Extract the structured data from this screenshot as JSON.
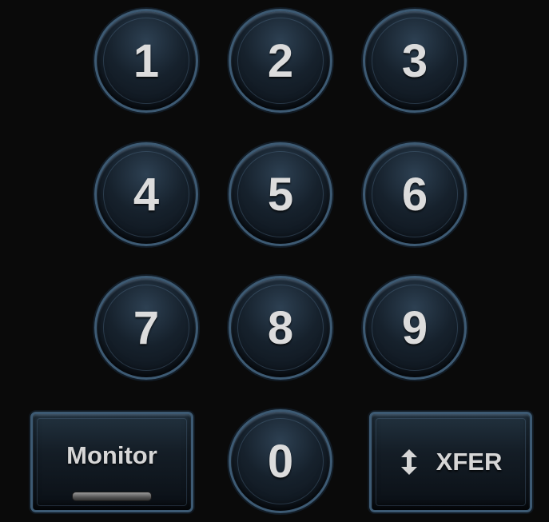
{
  "keypad": {
    "keys": [
      {
        "label": "1"
      },
      {
        "label": "2"
      },
      {
        "label": "3"
      },
      {
        "label": "4"
      },
      {
        "label": "5"
      },
      {
        "label": "6"
      },
      {
        "label": "7"
      },
      {
        "label": "8"
      },
      {
        "label": "9"
      },
      {
        "label": "0"
      }
    ],
    "monitor": {
      "label": "Monitor"
    },
    "xfer": {
      "label": "XFER",
      "icon": "up-down-arrow-icon"
    }
  },
  "colors": {
    "background": "#0a0a0a",
    "key_border": "#3d5a73",
    "key_text": "#dcdcdc"
  }
}
